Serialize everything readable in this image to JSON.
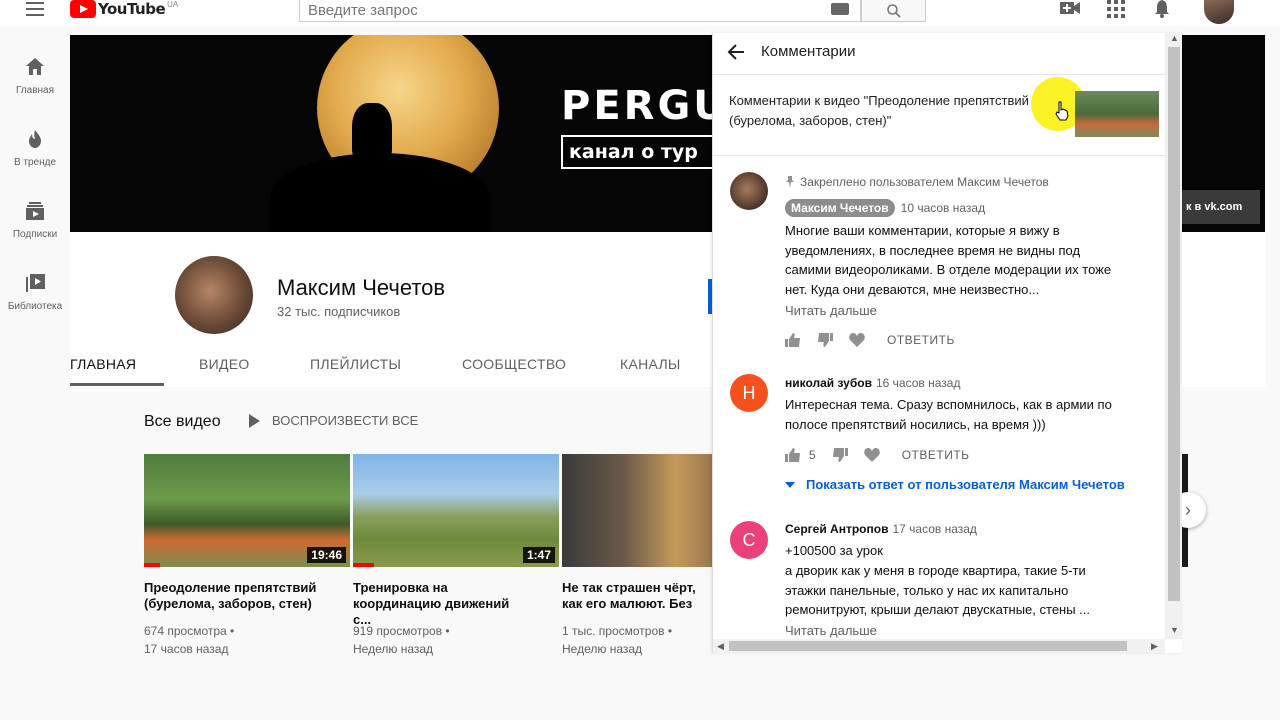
{
  "topbar": {
    "logo_text": "YouTube",
    "logo_region": "UA",
    "search_placeholder": "Введите запрос"
  },
  "sidebar": {
    "items": [
      {
        "label": "Главная",
        "icon": "home-icon"
      },
      {
        "label": "В тренде",
        "icon": "trending-icon"
      },
      {
        "label": "Подписки",
        "icon": "subscriptions-icon"
      },
      {
        "label": "Библиотека",
        "icon": "library-icon"
      }
    ]
  },
  "banner": {
    "title": "PERGU",
    "subtitle": "канал о тур",
    "link": "к в vk.com"
  },
  "channel": {
    "name": "Максим Чечетов",
    "subscribers": "32 тыс. подписчиков"
  },
  "tabs": [
    "ГЛАВНАЯ",
    "ВИДЕО",
    "ПЛЕЙЛИСТЫ",
    "СООБЩЕСТВО",
    "КАНАЛЫ"
  ],
  "section": {
    "title": "Все видео",
    "play_all": "ВОСПРОИЗВЕСТИ ВСЕ"
  },
  "videos": [
    {
      "title": "Преодоление препятствий (бурелома, заборов, стен)",
      "duration": "19:46",
      "views": "674 просмотра",
      "age": "17 часов назад",
      "progress": 0.08
    },
    {
      "title": "Тренировка на координацию движений с...",
      "duration": "1:47",
      "views": "919 просмотров",
      "age": "Неделю назад",
      "progress": 0.1
    },
    {
      "title": "Не так страшен чёрт, как его малюют. Без паники",
      "duration": "",
      "views": "1 тыс. просмотров",
      "age": "Неделю назад",
      "progress": 0
    }
  ],
  "comments_panel": {
    "title": "Комментарии",
    "video_ref": "Комментарии к видео \"Преодоление препятствий (бурелома, заборов, стен)\"",
    "comments": [
      {
        "pinned": "Закреплено пользователем Максим Чечетов",
        "author": "Максим Чечетов",
        "time": "10 часов назад",
        "text": "Многие ваши комментарии, которые я вижу в уведомлениях, в последнее время не видны под самими видеороликами. В отделе модерации их тоже нет. Куда они деваются, мне неизвестно...",
        "read_more": "Читать дальше",
        "likes": "",
        "reply": "ОТВЕТИТЬ"
      },
      {
        "avatar_letter": "Н",
        "avatar_color": "#f4511e",
        "author": "николай зубов",
        "time": "16 часов назад",
        "text": "Интересная тема. Сразу вспомнилось, как в армии по полосе препятствий носились, на время )))",
        "likes": "5",
        "reply": "ОТВЕТИТЬ",
        "show_reply": "Показать ответ от пользователя Максим Чечетов"
      },
      {
        "avatar_letter": "С",
        "avatar_color": "#ec407a",
        "author": "Сергей Антропов",
        "time": "17 часов назад",
        "text_line1": "+100500 за урок",
        "text": "а дворик как у меня в городе квартира, такие 5-ти этажки панельные, только у нас их капитально ремонитруют, крыши делают двускатные, стены ...",
        "read_more": "Читать дальше"
      }
    ]
  }
}
